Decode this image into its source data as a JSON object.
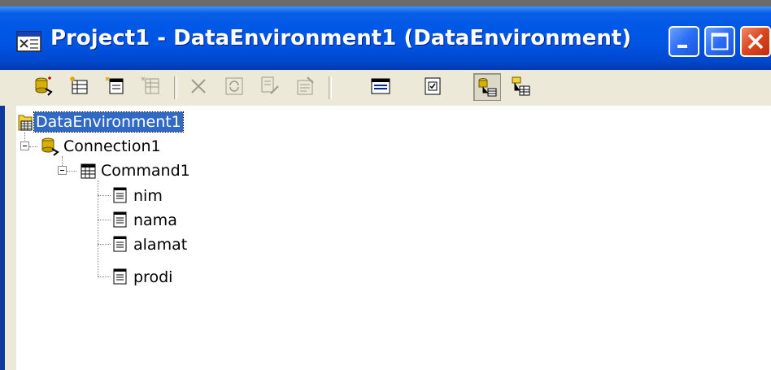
{
  "window": {
    "title": "Project1 - DataEnvironment1 (DataEnvironment)",
    "colors": {
      "titlebar": "#0054e3",
      "selection": "#316ac5",
      "close_button": "#d9461f"
    }
  },
  "caption_buttons": [
    {
      "name": "minimize-button",
      "icon": "minimize-icon"
    },
    {
      "name": "maximize-button",
      "icon": "maximize-icon"
    },
    {
      "name": "close-button",
      "icon": "close-icon"
    }
  ],
  "toolbar": {
    "buttons": [
      {
        "name": "add-connection-button",
        "icon": "add-connection-icon",
        "enabled": true
      },
      {
        "name": "add-command-button",
        "icon": "add-command-icon",
        "enabled": true
      },
      {
        "name": "add-child-command-button",
        "icon": "add-child-command-icon",
        "enabled": true
      },
      {
        "name": "insert-stored-procedures-button",
        "icon": "insert-stored-procedures-icon",
        "enabled": false
      },
      {
        "name": "delete-button",
        "icon": "delete-icon",
        "enabled": false
      },
      {
        "name": "refresh-button",
        "icon": "refresh-icon",
        "enabled": false
      },
      {
        "name": "design-button",
        "icon": "design-icon",
        "enabled": false
      },
      {
        "name": "properties-button",
        "icon": "properties-icon",
        "enabled": false
      },
      {
        "name": "view-code-button",
        "icon": "view-code-icon",
        "enabled": true
      },
      {
        "name": "options-button",
        "icon": "options-icon",
        "enabled": true
      },
      {
        "name": "arrange-by-connections-button",
        "icon": "arrange-by-connections-icon",
        "enabled": true,
        "pressed": true
      },
      {
        "name": "arrange-by-objects-button",
        "icon": "arrange-by-objects-icon",
        "enabled": true
      }
    ]
  },
  "tree": {
    "root": {
      "label": "DataEnvironment1",
      "selected": true
    },
    "connection": {
      "label": "Connection1",
      "expanded": true
    },
    "command": {
      "label": "Command1",
      "expanded": true
    },
    "fields": [
      {
        "label": "nim"
      },
      {
        "label": "nama"
      },
      {
        "label": "alamat"
      },
      {
        "label": "prodi"
      }
    ]
  }
}
